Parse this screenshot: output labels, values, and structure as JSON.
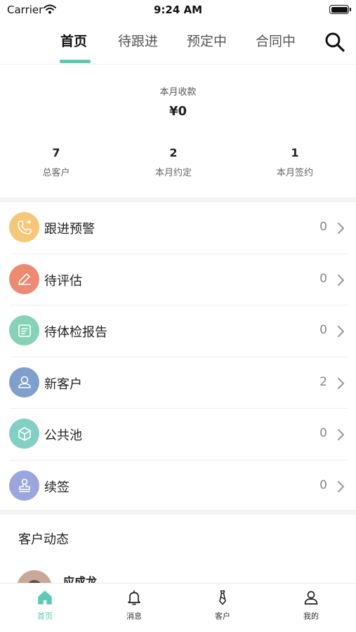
{
  "status_bar": {
    "carrier": "Carrier",
    "time": "9:24 AM"
  },
  "tabs": [
    {
      "label": "首页",
      "active": true
    },
    {
      "label": "待跟进",
      "active": false
    },
    {
      "label": "预定中",
      "active": false
    },
    {
      "label": "合同中",
      "active": false
    }
  ],
  "summary": {
    "revenue_label": "本月收款",
    "revenue_value": "¥0",
    "stats": [
      {
        "value": "7",
        "label": "总客户"
      },
      {
        "value": "2",
        "label": "本月约定"
      },
      {
        "value": "1",
        "label": "本月签约"
      }
    ]
  },
  "list": [
    {
      "title": "跟进预警",
      "count": "0",
      "icon": "phone-icon",
      "color": "#f5c778"
    },
    {
      "title": "待评估",
      "count": "0",
      "icon": "pencil-icon",
      "color": "#ec8a72"
    },
    {
      "title": "待体检报告",
      "count": "0",
      "icon": "report-icon",
      "color": "#86d2b6"
    },
    {
      "title": "新客户",
      "count": "2",
      "icon": "person-icon",
      "color": "#7f9fcc"
    },
    {
      "title": "公共池",
      "count": "0",
      "icon": "box-icon",
      "color": "#84cfc4"
    },
    {
      "title": "续签",
      "count": "0",
      "icon": "stamp-icon",
      "color": "#9aa6dc"
    }
  ],
  "activity": {
    "heading": "客户动态",
    "first_name": "应成龙"
  },
  "bottom_nav": [
    {
      "label": "首页",
      "icon": "home-icon",
      "active": true
    },
    {
      "label": "消息",
      "icon": "bell-icon",
      "active": false
    },
    {
      "label": "客户",
      "icon": "tie-icon",
      "active": false
    },
    {
      "label": "我的",
      "icon": "user-icon",
      "active": false
    }
  ],
  "colors": {
    "accent": "#5fc8b4"
  }
}
